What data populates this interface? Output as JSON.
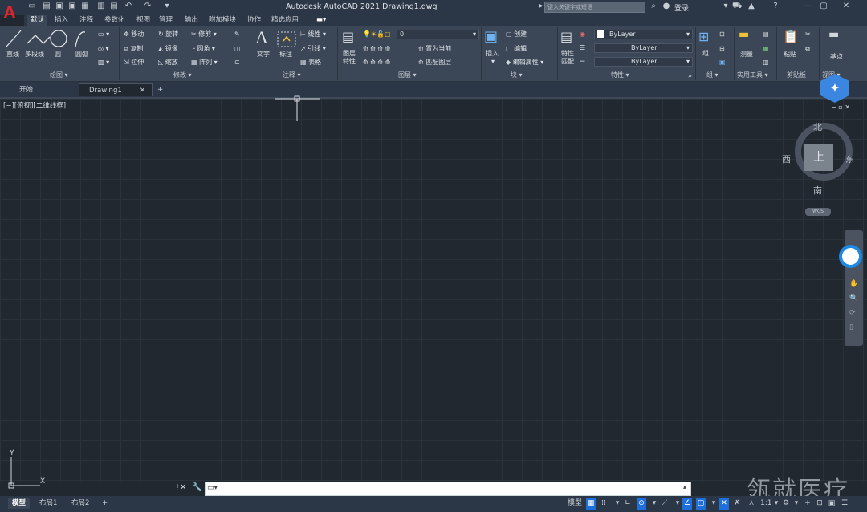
{
  "app": {
    "title": "Autodesk AutoCAD 2021    Drawing1.dwg",
    "logo": "A",
    "search_placeholder": "键入关键字或短语",
    "login": "登录"
  },
  "ribbon_tabs": [
    "默认",
    "插入",
    "注释",
    "参数化",
    "视图",
    "管理",
    "输出",
    "附加模块",
    "协作",
    "精选应用"
  ],
  "panels": {
    "draw": {
      "title": "绘图 ▾",
      "line": "直线",
      "polyline": "多段线",
      "circle": "圆",
      "arc": "圆弧"
    },
    "modify": {
      "title": "修改 ▾",
      "move": "移动",
      "rotate": "旋转",
      "trim": "修剪",
      "copy": "复制",
      "mirror": "镜像",
      "fillet": "圆角",
      "stretch": "拉伸",
      "scale": "缩放",
      "array": "阵列"
    },
    "annotation": {
      "title": "注释 ▾",
      "text": "文字",
      "dimension": "标注",
      "linear": "线性",
      "leader": "引线",
      "table": "表格"
    },
    "layers": {
      "title": "图层 ▾",
      "properties": "图层\n特性",
      "current_layer": "0",
      "set_current": "置为当前",
      "match_layer": "匹配图层"
    },
    "block": {
      "title": "块 ▾",
      "insert": "插入",
      "create": "创建",
      "edit": "编辑",
      "edit_attr": "编辑属性"
    },
    "properties": {
      "title": "特性 ▾",
      "match": "特性\n匹配",
      "color": "ByLayer",
      "linetype": "ByLayer",
      "lineweight": "ByLayer"
    },
    "groups": {
      "title": "组 ▾",
      "group": "组"
    },
    "utilities": {
      "title": "实用工具 ▾",
      "measure": "测量"
    },
    "clipboard": {
      "title": "剪贴板",
      "paste": "粘贴"
    },
    "view": {
      "title": "视图 ▾",
      "base": "基点"
    }
  },
  "doc_tabs": {
    "start": "开始",
    "drawing": "Drawing1"
  },
  "viewport": {
    "label": "[−][俯视][二维线框]"
  },
  "viewcube": {
    "north": "北",
    "south": "南",
    "east": "东",
    "west": "西",
    "face": "上",
    "wcs": "WCS"
  },
  "ucs": {
    "x": "X",
    "y": "Y"
  },
  "cmd": {
    "placeholder": ""
  },
  "status": {
    "tabs": [
      "模型",
      "布局1",
      "布局2"
    ],
    "model_label": "模型",
    "scale": "1:1"
  },
  "watermark": "瓴就医疗"
}
